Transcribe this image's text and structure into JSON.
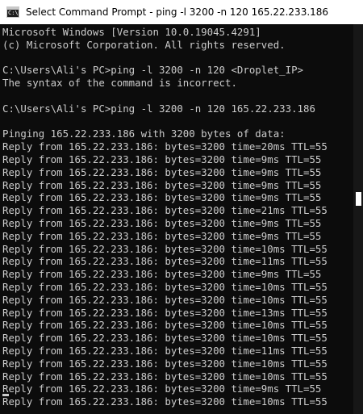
{
  "window": {
    "title": "Select Command Prompt - ping  -l 3200 -n 120 165.22.233.186",
    "icon": "cmd-icon",
    "icon_glyph": "C:\\"
  },
  "colors": {
    "background": "#0c0c0c",
    "text": "#cccccc",
    "titlebar": "#ffffff"
  },
  "console": {
    "lines": [
      "Microsoft Windows [Version 10.0.19045.4291]",
      "(c) Microsoft Corporation. All rights reserved.",
      "",
      "C:\\Users\\Ali's PC>ping -l 3200 -n 120 <Droplet_IP>",
      "The syntax of the command is incorrect.",
      "",
      "C:\\Users\\Ali's PC>ping -l 3200 -n 120 165.22.233.186",
      "",
      "Pinging 165.22.233.186 with 3200 bytes of data:",
      "Reply from 165.22.233.186: bytes=3200 time=20ms TTL=55",
      "Reply from 165.22.233.186: bytes=3200 time=9ms TTL=55",
      "Reply from 165.22.233.186: bytes=3200 time=9ms TTL=55",
      "Reply from 165.22.233.186: bytes=3200 time=9ms TTL=55",
      "Reply from 165.22.233.186: bytes=3200 time=9ms TTL=55",
      "Reply from 165.22.233.186: bytes=3200 time=21ms TTL=55",
      "Reply from 165.22.233.186: bytes=3200 time=9ms TTL=55",
      "Reply from 165.22.233.186: bytes=3200 time=9ms TTL=55",
      "Reply from 165.22.233.186: bytes=3200 time=10ms TTL=55",
      "Reply from 165.22.233.186: bytes=3200 time=11ms TTL=55",
      "Reply from 165.22.233.186: bytes=3200 time=9ms TTL=55",
      "Reply from 165.22.233.186: bytes=3200 time=10ms TTL=55",
      "Reply from 165.22.233.186: bytes=3200 time=10ms TTL=55",
      "Reply from 165.22.233.186: bytes=3200 time=13ms TTL=55",
      "Reply from 165.22.233.186: bytes=3200 time=10ms TTL=55",
      "Reply from 165.22.233.186: bytes=3200 time=10ms TTL=55",
      "Reply from 165.22.233.186: bytes=3200 time=11ms TTL=55",
      "Reply from 165.22.233.186: bytes=3200 time=10ms TTL=55",
      "Reply from 165.22.233.186: bytes=3200 time=10ms TTL=55",
      "Reply from 165.22.233.186: bytes=3200 time=9ms TTL=55",
      "Reply from 165.22.233.186: bytes=3200 time=10ms TTL=55"
    ]
  }
}
